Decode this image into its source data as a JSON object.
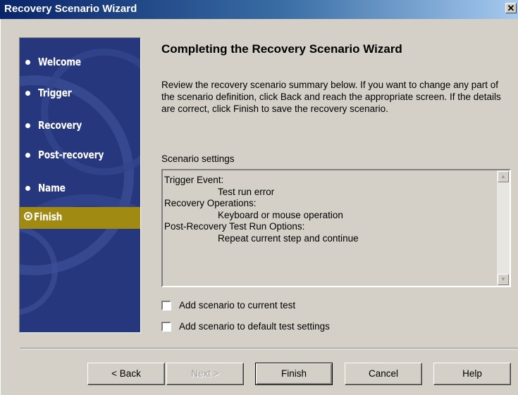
{
  "window": {
    "title": "Recovery Scenario Wizard",
    "close_glyph": "✕"
  },
  "sidebar": {
    "items": [
      {
        "label": "Welcome",
        "active": false
      },
      {
        "label": "Trigger",
        "active": false
      },
      {
        "label": "Recovery",
        "active": false
      },
      {
        "label": "Post-recovery",
        "active": false
      },
      {
        "label": "Name",
        "active": false
      },
      {
        "label": "Finish",
        "active": true
      }
    ],
    "active_color": "#a08a12",
    "background_color": "#26377d"
  },
  "main": {
    "heading": "Completing the Recovery Scenario Wizard",
    "description": "Review the recovery scenario summary below. If you want to change any part of the scenario definition, click Back and reach the appropriate screen. If the details are correct, click Finish to save the recovery scenario.",
    "settings_label": "Scenario settings",
    "summary": {
      "trigger_event_label": "Trigger Event:",
      "trigger_event_value": "Test run error",
      "recovery_ops_label": "Recovery Operations:",
      "recovery_ops_value": "Keyboard or mouse operation",
      "post_recovery_label": "Post-Recovery Test Run Options:",
      "post_recovery_value": "Repeat current step and continue"
    },
    "checkboxes": [
      {
        "label": "Add scenario to current test",
        "checked": false
      },
      {
        "label": "Add scenario to default test settings",
        "checked": false
      }
    ]
  },
  "buttons": {
    "back": "< Back",
    "next": "Next >",
    "finish": "Finish",
    "cancel": "Cancel",
    "help": "Help"
  }
}
